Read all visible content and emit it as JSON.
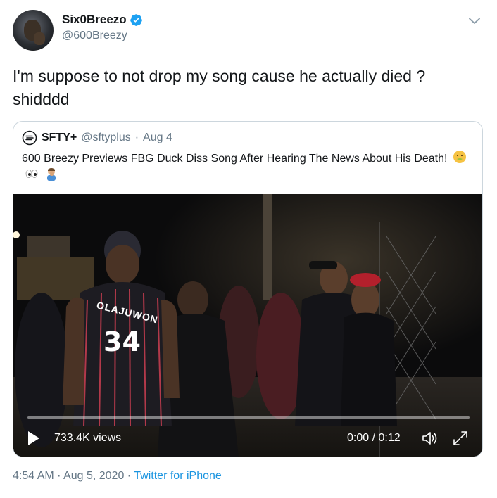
{
  "author": {
    "display_name": "Six0Breezo",
    "handle": "@600Breezy",
    "verified": true
  },
  "tweet": {
    "text": "I'm suppose to not drop my song cause he actually died ? shidddd"
  },
  "quoted_tweet": {
    "display_name": "SFTY+",
    "handle": "@sftyplus",
    "separator": "·",
    "date": "Aug 4",
    "text": "600 Breezy Previews FBG Duck Diss Song After Hearing The News About His Death!",
    "emojis": [
      "nauseated-face-emoji",
      "eyes-emoji",
      "man-facepalming-emoji"
    ],
    "video": {
      "views": "733.4K views",
      "time": "0:00 / 0:12",
      "progress": 0,
      "jersey_name": "OLAJUWON",
      "jersey_number": "34"
    }
  },
  "footer": {
    "time": "4:54 AM",
    "sep1": "·",
    "date": "Aug 5, 2020",
    "sep2": "·",
    "source": "Twitter for iPhone"
  },
  "colors": {
    "text": "#14171a",
    "secondary": "#657786",
    "link": "#1b95e0",
    "verified": "#1da1f2",
    "border": "#ccd6dd"
  }
}
